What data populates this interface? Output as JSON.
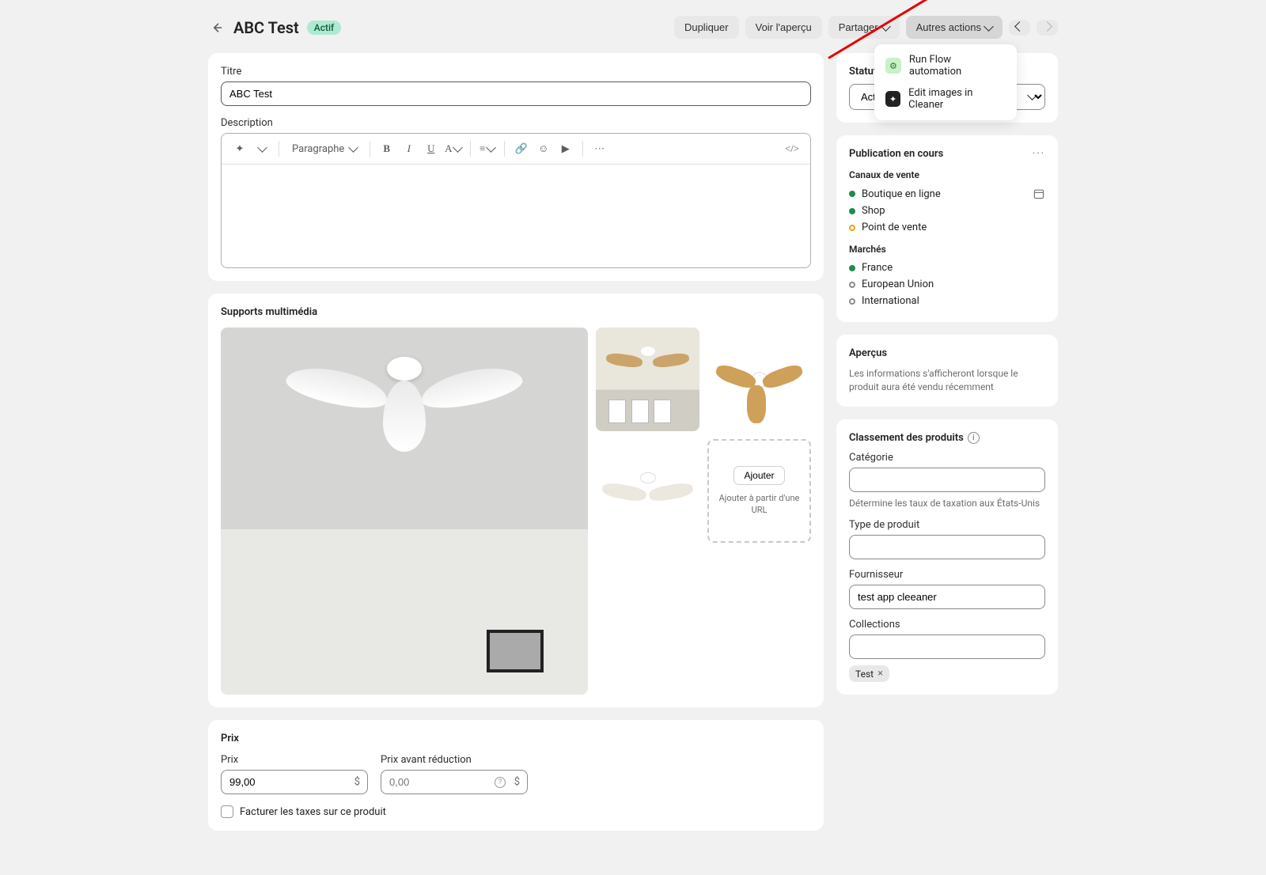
{
  "header": {
    "title": "ABC Test",
    "status_badge": "Actif",
    "buttons": {
      "duplicate": "Dupliquer",
      "preview": "Voir l'aperçu",
      "share": "Partager",
      "more": "Autres actions"
    },
    "more_menu": {
      "item1": "Run Flow automation",
      "item2": "Edit images in Cleaner"
    }
  },
  "title_section": {
    "label": "Titre",
    "value": "ABC Test"
  },
  "description": {
    "label": "Description",
    "toolbar": {
      "paragraph": "Paragraphe"
    }
  },
  "media": {
    "heading": "Supports multimédia",
    "add_btn": "Ajouter",
    "add_url": "Ajouter à partir d'une URL"
  },
  "pricing": {
    "heading": "Prix",
    "price_label": "Prix",
    "price_value": "99,00",
    "compare_label": "Prix avant réduction",
    "compare_placeholder": "0,00",
    "currency": "$",
    "tax_checkbox": "Facturer les taxes sur ce produit"
  },
  "status": {
    "label": "Statut",
    "value": "Actif"
  },
  "publication": {
    "heading": "Publication en cours",
    "channels_label": "Canaux de vente",
    "channels": {
      "c0": "Boutique en ligne",
      "c1": "Shop",
      "c2": "Point de vente"
    },
    "markets_label": "Marchés",
    "markets": {
      "m0": "France",
      "m1": "European Union",
      "m2": "International"
    }
  },
  "insights": {
    "heading": "Aperçus",
    "text": "Les informations s'afficheront lorsque le produit aura été vendu récemment"
  },
  "organization": {
    "heading": "Classement des produits",
    "category_label": "Catégorie",
    "category_help": "Détermine les taux de taxation aux États-Unis",
    "type_label": "Type de produit",
    "vendor_label": "Fournisseur",
    "vendor_value": "test app cleeaner",
    "collections_label": "Collections",
    "tag": "Test"
  }
}
